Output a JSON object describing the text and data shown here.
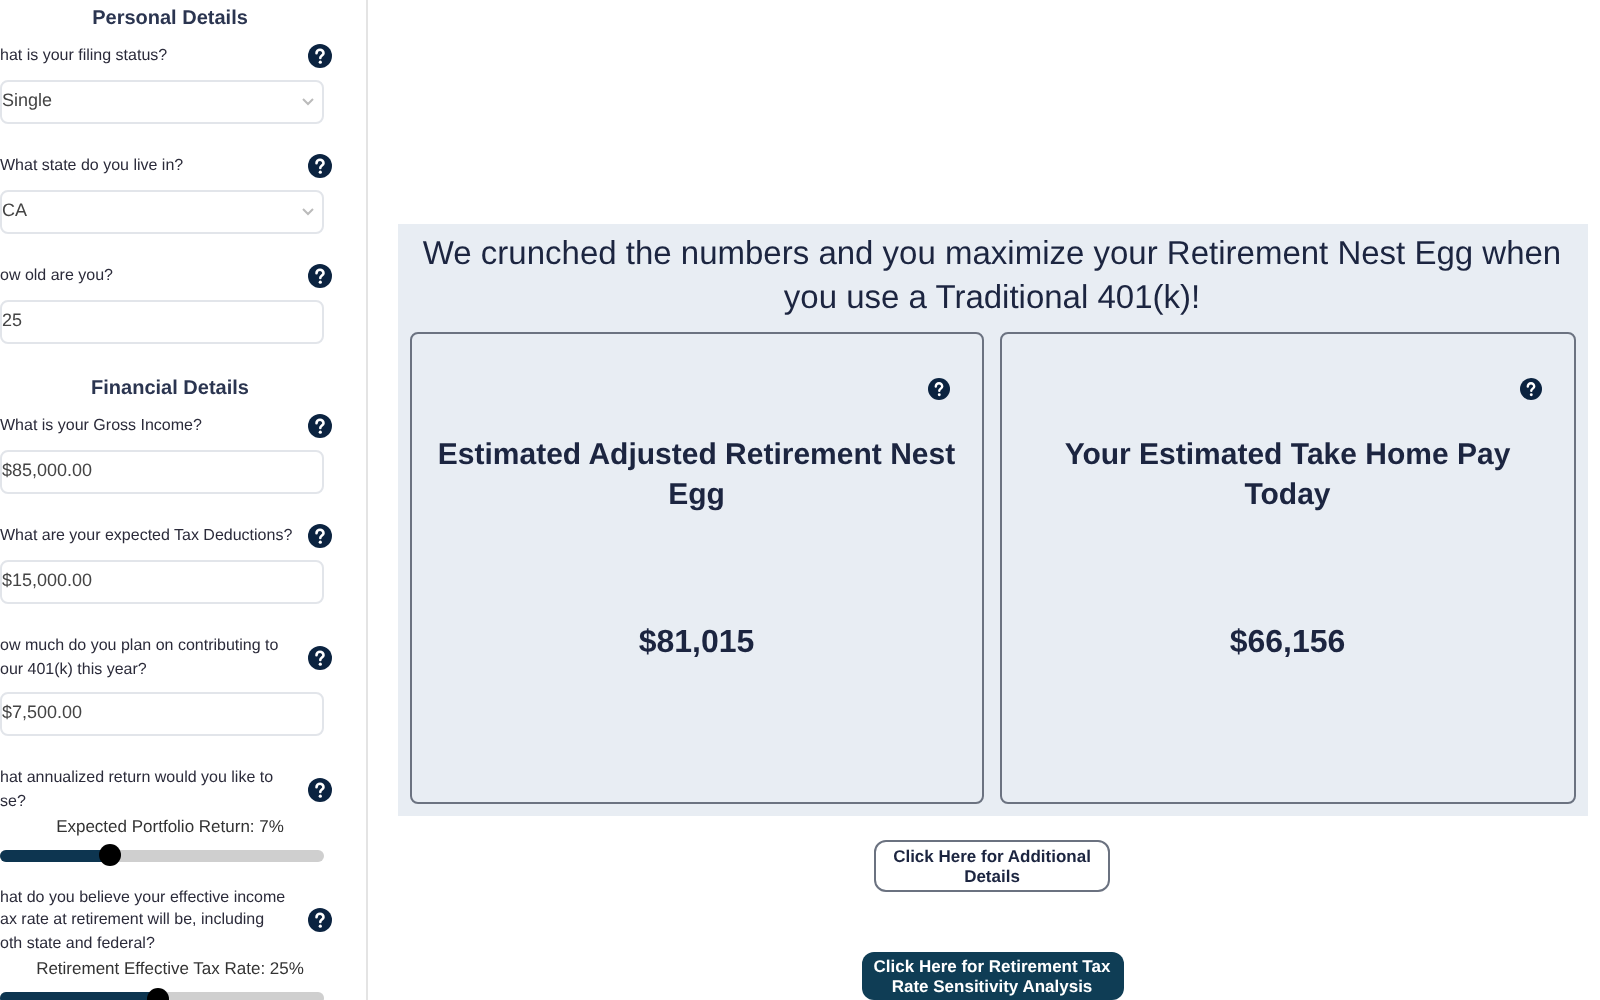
{
  "sidebar": {
    "sections": [
      {
        "heading": "Personal Details",
        "fields": [
          {
            "kind": "select",
            "label": "hat is your filing status?",
            "value": "Single"
          },
          {
            "kind": "select",
            "label": "What state do you live in?",
            "value": "CA"
          },
          {
            "kind": "input",
            "label": "ow old are you?",
            "value": "25"
          }
        ]
      },
      {
        "heading": "Financial Details",
        "fields": [
          {
            "kind": "input",
            "label": "What is your Gross Income?",
            "value": "$85,000.00"
          },
          {
            "kind": "input",
            "label": "What are your expected Tax Deductions?",
            "value": "$15,000.00"
          },
          {
            "kind": "input",
            "label": "ow much do you plan on contributing to\nour 401(k) this year?",
            "value": "$7,500.00"
          },
          {
            "kind": "slider",
            "label": "hat annualized return would you like to\nse?",
            "caption": "Expected Portfolio Return: 7%",
            "level": 0.34
          },
          {
            "kind": "slider",
            "label": "hat do you believe your effective income\nax rate at retirement will be, including\noth state and federal?",
            "caption": "Retirement Effective Tax Rate: 25%",
            "level": 0.49
          }
        ]
      }
    ]
  },
  "result": {
    "headline": "We crunched the numbers and you maximize your Retirement Nest Egg when you use a Traditional 401(k)!",
    "cards": [
      {
        "title": "Estimated Adjusted Retirement Nest Egg",
        "value": "$81,015"
      },
      {
        "title": "Your Estimated Take Home Pay Today",
        "value": "$66,156"
      }
    ]
  },
  "buttons": [
    {
      "kind": "outline",
      "label": "Click Here for Additional Details"
    },
    {
      "kind": "filled",
      "label": "Click Here for Retirement Tax Rate Sensitivity Analysis"
    }
  ]
}
